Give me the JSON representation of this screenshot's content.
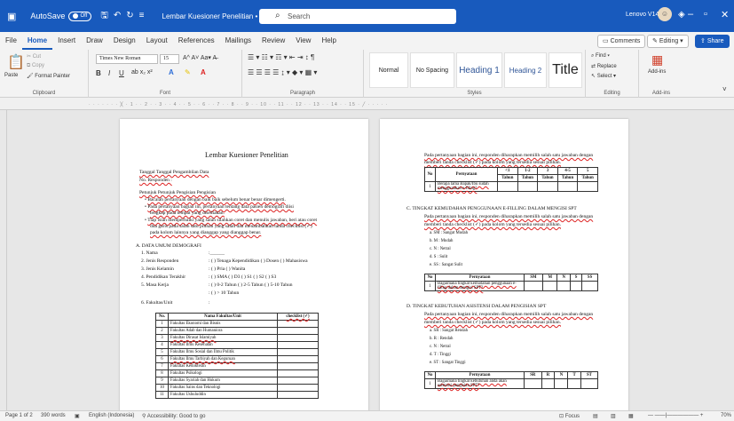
{
  "titlebar": {
    "autosave": "AutoSave",
    "toggle": "Off",
    "doc_title": "Lembar Kuesioner Penelitian • Saved",
    "search_placeholder": "Search",
    "user": "Lenovo V14"
  },
  "tabs": [
    "File",
    "Home",
    "Insert",
    "Draw",
    "Design",
    "Layout",
    "References",
    "Mailings",
    "Review",
    "View",
    "Help"
  ],
  "ribbon_right": {
    "comments": "Comments",
    "editing": "Editing",
    "share": "Share"
  },
  "clipboard": {
    "paste": "Paste",
    "cut": "Cut",
    "copy": "Copy",
    "format_painter": "Format Painter",
    "label": "Clipboard"
  },
  "font": {
    "name": "Times New Roman",
    "size": "15",
    "label": "Font"
  },
  "paragraph": {
    "label": "Paragraph"
  },
  "styles": {
    "items": [
      "Normal",
      "No Spacing",
      "Heading 1",
      "Heading 2",
      "Title"
    ],
    "label": "Styles"
  },
  "editing": {
    "find": "Find",
    "replace": "Replace",
    "select": "Select",
    "label": "Editing"
  },
  "addins": {
    "label": "Add-ins",
    "label2": "Add-ins"
  },
  "page1": {
    "title": "Lembar Kuesioner Penelitian",
    "tanggal": "Tanggal Tanggal Pengambilan Data",
    "no": "No. Responden :",
    "petunjuk": "Petunjuk Petunjuk Pengisian Pengisian",
    "bullets": [
      "Bacalah pertanyaan dengan baik baik sebelum benar benar dimengerti.",
      "Pada pertanyaan bagian ini, pertanyaan tentang data pasien demografi diisi",
      "lengkap pada tempat yang disediakan.",
      "Tiap isian memperbaiki yang salah silahkan coret dan menulis jawaban, beri atau coret",
      "dua garis pada salah satu pilihan yang salah dan menambahkan tanda checklist (✓)",
      "pada kolom lainnya yang dianggap yang dianggap benar."
    ],
    "section_a": "A.  DATA UMUM DEMOGRAFI",
    "fields": [
      [
        "1.  Nama",
        ":______"
      ],
      [
        "2.  Jenis Responden",
        ": (  ) Tenaga Kependidikan (  ) Dosen (  ) Mahasiswa"
      ],
      [
        "3.  Jenis Kelamin",
        ": (  ) Pria (  ) Wanita"
      ],
      [
        "4.  Pendidikan Terakhir",
        ": (  ) SMA (  ) D3 (  ) S1 (  ) S2 (  ) S3"
      ],
      [
        "5.  Masa Kerja",
        ": (  ) 0-2 Tahun (  ) 2-5 Tahun (  ) 5-10 Tahun"
      ],
      [
        "",
        ": (  ) > 10 Tahun"
      ],
      [
        "6.  Fakultas/Unit",
        ":"
      ]
    ],
    "table_headers": [
      "No.",
      "Nama Fakultas/Unit",
      "checklist (✓)"
    ],
    "table_rows": [
      [
        "1",
        "Fakultas Ekonomi dan Bisnis"
      ],
      [
        "2",
        "Fakultas Adab dan Humaniora"
      ],
      [
        "3",
        "Fakultas Dirasat Islamiyah"
      ],
      [
        "4",
        "Fakultas Ilmu Kesehatan"
      ],
      [
        "5",
        "Fakultas Ilmu Sosial dan Ilmu Politik"
      ],
      [
        "6",
        "Fakultas Ilmu Tarbiyah dan Keguruan"
      ],
      [
        "7",
        "Fakultas Kedokteran"
      ],
      [
        "8",
        "Fakultas Psikologi"
      ],
      [
        "9",
        "Fakultas Syariah dan Hukum"
      ],
      [
        "10",
        "Fakultas Sains dan Teknologi"
      ],
      [
        "11",
        "Fakultas Ushuluddin"
      ]
    ]
  },
  "page2": {
    "intro": [
      "Pada pertanyaan bagian ini, responden diharapkan memilih salah satu jawaban dengan",
      "memberi tanda checklist (✓) pada kolom yang tersedia sesuai pilihan."
    ],
    "t1_headers": [
      "No",
      "Pernyataan",
      "<1",
      "1-2",
      "3",
      "4-5",
      "5"
    ],
    "t1_sub": "Tahun",
    "t1_row": [
      "1",
      "Berapa lama Bapak/Ibu sudah menggunakan e-filing?"
    ],
    "section_c": "C.  TINGKAT KEMUDAHAN PENGGUNAAN E-FILLING DALAM MENGISI SPT",
    "c_intro": [
      "Pada pertanyaan bagian ini, responden diharapkan memilih salah satu jawaban dengan",
      "memberi tanda checklist (✓) pada kolom yang tersedia sesuai pilihan."
    ],
    "c_scale": [
      "a.  SM : Sangat Mudah",
      "b.  M : Mudah",
      "c.  N : Netral",
      "d.  S : Sulit",
      "e.  SS : Sangat Sulit"
    ],
    "t2_headers": [
      "No",
      "Pernyataan",
      "SM",
      "M",
      "N",
      "S",
      "SS"
    ],
    "t2_row": [
      "1",
      "Bagaimana tingkat kemudahan penggunaan e-filing dalam mengisi SPT?"
    ],
    "section_d": "D.  TINGKAT KEBUTUHAN ASISTENSI DALAM PENGISIAN SPT",
    "d_intro": [
      "Pada pertanyaan bagian ini, responden diharapkan memilih salah satu jawaban dengan",
      "memberi tanda checklist (✓) pada kolom yang tersedia sesuai pilihan."
    ],
    "d_scale": [
      "a.  SR : Sangat Rendah",
      "b.  R : Rendah",
      "c.  N : Netral",
      "d.  T : Tinggi",
      "e.  ST : Sangat Tinggi"
    ],
    "t3_headers": [
      "No",
      "Pernyataan",
      "SR",
      "R",
      "N",
      "T",
      "ST"
    ],
    "t3_row": [
      "1",
      "Bagaimana tingkat kebutuhan anda akan asistensi pengisian SPT?"
    ]
  },
  "status": {
    "page": "Page 1 of 2",
    "words": "390 words",
    "language": "English (Indonesia)",
    "accessibility": "Accessibility: Good to go",
    "focus": "Focus",
    "zoom": "70%"
  }
}
